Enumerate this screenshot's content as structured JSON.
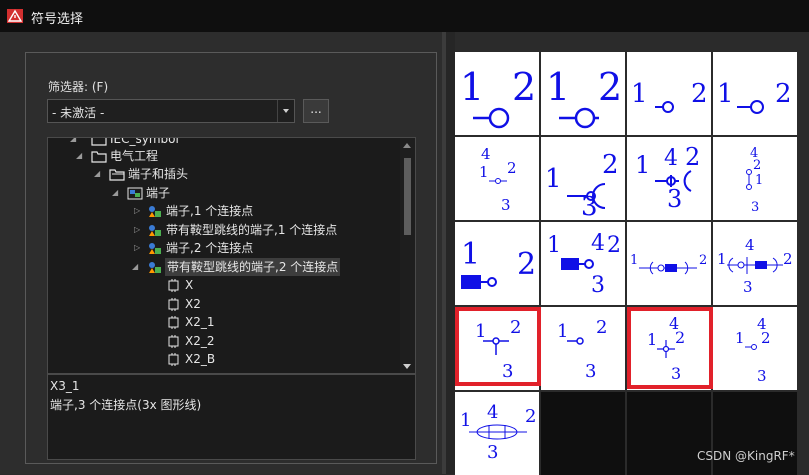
{
  "window": {
    "title": "符号选择"
  },
  "filter": {
    "label": "筛选器: (F)",
    "value": "- 未激活 -",
    "more_button": "..."
  },
  "tree": [
    {
      "label": "IEC_symbol",
      "icon": "folder-icon"
    },
    {
      "label": "电气工程",
      "icon": "folder-icon"
    },
    {
      "label": "端子和插头",
      "icon": "folder-open-icon"
    },
    {
      "label": "端子",
      "icon": "symbol-group-icon"
    },
    {
      "label": "端子,1 个连接点",
      "icon": "symbol-group-icon"
    },
    {
      "label": "带有鞍型跳线的端子,1 个连接点",
      "icon": "symbol-group-icon"
    },
    {
      "label": "端子,2 个连接点",
      "icon": "symbol-group-icon"
    },
    {
      "label": "带有鞍型跳线的端子,2 个连接点",
      "icon": "symbol-group-icon"
    },
    {
      "label": "X",
      "icon": "terminal-symbol-icon"
    },
    {
      "label": "X2",
      "icon": "terminal-symbol-icon"
    },
    {
      "label": "X2_1",
      "icon": "terminal-symbol-icon"
    },
    {
      "label": "X2_2",
      "icon": "terminal-symbol-icon"
    },
    {
      "label": "X2_B",
      "icon": "terminal-symbol-icon"
    }
  ],
  "description": {
    "name": "X3_1",
    "detail": "端子,3 个连接点(3x 图形线)"
  },
  "symbol_grid": {
    "numbers": {
      "one": "1",
      "two": "2",
      "three": "3",
      "four": "4"
    },
    "highlighted": [
      "r3c0",
      "r3c2"
    ]
  },
  "colors": {
    "symbol_blue": "#1010e6",
    "highlight_red": "#e1212a",
    "app_icon_red": "#d32f2f"
  },
  "watermark": "CSDN @KingRF*"
}
